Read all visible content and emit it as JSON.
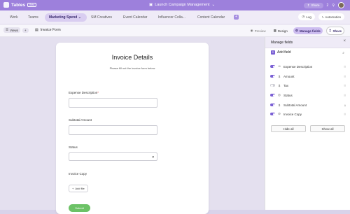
{
  "app": {
    "name": "Tables",
    "badge": "Beta",
    "title": "Launch Campaign Management",
    "share_label": "Share",
    "share_count": "2",
    "log_label": "Log",
    "automation_label": "Automation"
  },
  "tabs": [
    {
      "label": "Work"
    },
    {
      "label": "Teams"
    },
    {
      "label": "Marketing Spend"
    },
    {
      "label": "SM Creatives"
    },
    {
      "label": "Event Calendar"
    },
    {
      "label": "Influencer Colla..."
    },
    {
      "label": "Content Calendar"
    }
  ],
  "toolbar": {
    "views_label": "Views",
    "form_name": "Invoice Form",
    "preview_label": "Preview",
    "design_label": "Design",
    "manage_label": "Manage fields",
    "share_label": "Share"
  },
  "form": {
    "title": "Invoice Details",
    "subtitle": "Please fill out the invoice form below",
    "fields": {
      "expense": "Expense Description",
      "expense_required": "*",
      "subtotal": "Subtotal Amount",
      "status": "Status",
      "copy": "Invoice Copy"
    },
    "add_file_label": "Add file",
    "submit_label": "Submit"
  },
  "panel": {
    "title": "Manage fields",
    "add_field_label": "Add field",
    "fields": [
      {
        "name": "Expense Description",
        "enabled": true,
        "icon": "text-icon"
      },
      {
        "name": "Amount",
        "enabled": true,
        "icon": "dollar-icon"
      },
      {
        "name": "Tax",
        "enabled": false,
        "icon": "dollar-icon"
      },
      {
        "name": "Status",
        "enabled": true,
        "icon": "status-icon"
      },
      {
        "name": "Subtotal Amount",
        "enabled": true,
        "icon": "dollar-icon"
      },
      {
        "name": "Invoice Copy",
        "enabled": true,
        "icon": "attachment-icon"
      }
    ],
    "hide_all_label": "Hide all",
    "show_all_label": "Show all"
  },
  "colors": {
    "accent": "#9d80dc",
    "submit": "#6cc266"
  }
}
